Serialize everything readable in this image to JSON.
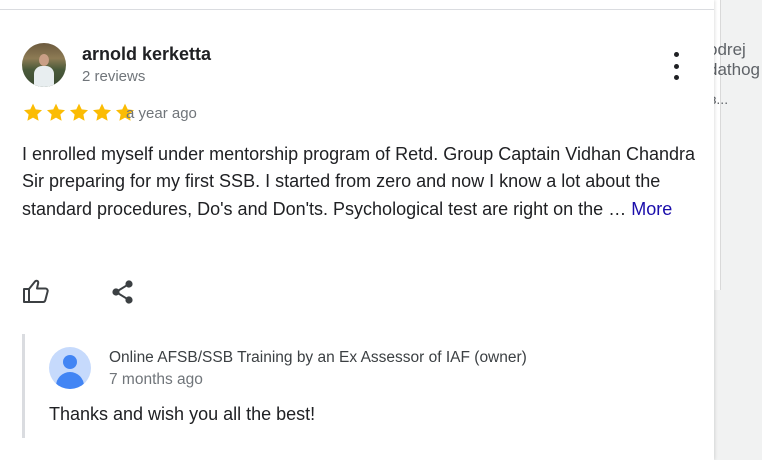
{
  "background_card": {
    "line1": "odrej",
    "line2": "dathog",
    "line3": "з..."
  },
  "review": {
    "reviewer_name": "arnold kerketta",
    "review_count": "2 reviews",
    "rating": 5,
    "rating_max": 5,
    "date": "a year ago",
    "text": "I enrolled myself under mentorship program of Retd. Group Captain Vidhan Chandra Sir preparing for my first SSB. I started from zero and now I know a lot about the standard procedures, Do's and Don'ts. Psychological test are right on the … ",
    "more_label": "More",
    "icons": {
      "more_options": "more-vert-icon",
      "like": "thumb-up-icon",
      "share": "share-icon"
    }
  },
  "owner_reply": {
    "owner_name": "Online AFSB/SSB Training by an Ex Assessor of IAF (owner)",
    "date": "7 months ago",
    "text": "Thanks and wish you all the best!"
  },
  "colors": {
    "star": "#fbbc04",
    "link": "#1a0dab",
    "text": "#202124",
    "secondary": "#70757a"
  }
}
